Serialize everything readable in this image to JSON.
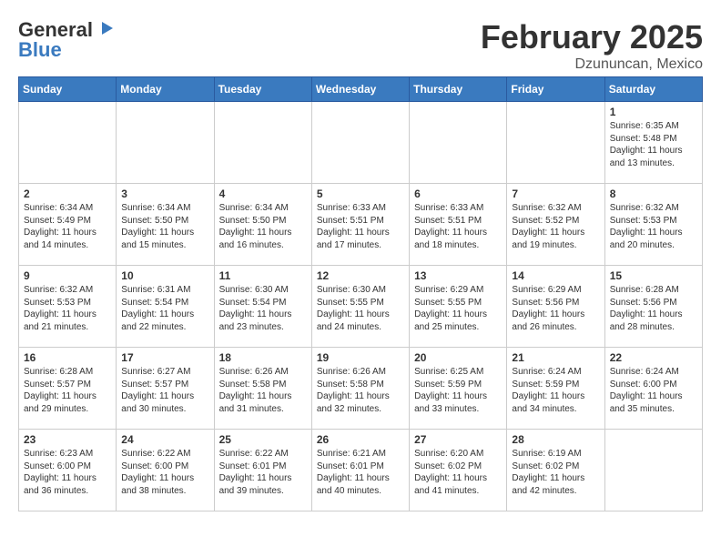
{
  "logo": {
    "general": "General",
    "blue": "Blue"
  },
  "header": {
    "title": "February 2025",
    "subtitle": "Dzununcan, Mexico"
  },
  "weekdays": [
    "Sunday",
    "Monday",
    "Tuesday",
    "Wednesday",
    "Thursday",
    "Friday",
    "Saturday"
  ],
  "weeks": [
    [
      {
        "day": "",
        "info": ""
      },
      {
        "day": "",
        "info": ""
      },
      {
        "day": "",
        "info": ""
      },
      {
        "day": "",
        "info": ""
      },
      {
        "day": "",
        "info": ""
      },
      {
        "day": "",
        "info": ""
      },
      {
        "day": "1",
        "info": "Sunrise: 6:35 AM\nSunset: 5:48 PM\nDaylight: 11 hours\nand 13 minutes."
      }
    ],
    [
      {
        "day": "2",
        "info": "Sunrise: 6:34 AM\nSunset: 5:49 PM\nDaylight: 11 hours\nand 14 minutes."
      },
      {
        "day": "3",
        "info": "Sunrise: 6:34 AM\nSunset: 5:50 PM\nDaylight: 11 hours\nand 15 minutes."
      },
      {
        "day": "4",
        "info": "Sunrise: 6:34 AM\nSunset: 5:50 PM\nDaylight: 11 hours\nand 16 minutes."
      },
      {
        "day": "5",
        "info": "Sunrise: 6:33 AM\nSunset: 5:51 PM\nDaylight: 11 hours\nand 17 minutes."
      },
      {
        "day": "6",
        "info": "Sunrise: 6:33 AM\nSunset: 5:51 PM\nDaylight: 11 hours\nand 18 minutes."
      },
      {
        "day": "7",
        "info": "Sunrise: 6:32 AM\nSunset: 5:52 PM\nDaylight: 11 hours\nand 19 minutes."
      },
      {
        "day": "8",
        "info": "Sunrise: 6:32 AM\nSunset: 5:53 PM\nDaylight: 11 hours\nand 20 minutes."
      }
    ],
    [
      {
        "day": "9",
        "info": "Sunrise: 6:32 AM\nSunset: 5:53 PM\nDaylight: 11 hours\nand 21 minutes."
      },
      {
        "day": "10",
        "info": "Sunrise: 6:31 AM\nSunset: 5:54 PM\nDaylight: 11 hours\nand 22 minutes."
      },
      {
        "day": "11",
        "info": "Sunrise: 6:30 AM\nSunset: 5:54 PM\nDaylight: 11 hours\nand 23 minutes."
      },
      {
        "day": "12",
        "info": "Sunrise: 6:30 AM\nSunset: 5:55 PM\nDaylight: 11 hours\nand 24 minutes."
      },
      {
        "day": "13",
        "info": "Sunrise: 6:29 AM\nSunset: 5:55 PM\nDaylight: 11 hours\nand 25 minutes."
      },
      {
        "day": "14",
        "info": "Sunrise: 6:29 AM\nSunset: 5:56 PM\nDaylight: 11 hours\nand 26 minutes."
      },
      {
        "day": "15",
        "info": "Sunrise: 6:28 AM\nSunset: 5:56 PM\nDaylight: 11 hours\nand 28 minutes."
      }
    ],
    [
      {
        "day": "16",
        "info": "Sunrise: 6:28 AM\nSunset: 5:57 PM\nDaylight: 11 hours\nand 29 minutes."
      },
      {
        "day": "17",
        "info": "Sunrise: 6:27 AM\nSunset: 5:57 PM\nDaylight: 11 hours\nand 30 minutes."
      },
      {
        "day": "18",
        "info": "Sunrise: 6:26 AM\nSunset: 5:58 PM\nDaylight: 11 hours\nand 31 minutes."
      },
      {
        "day": "19",
        "info": "Sunrise: 6:26 AM\nSunset: 5:58 PM\nDaylight: 11 hours\nand 32 minutes."
      },
      {
        "day": "20",
        "info": "Sunrise: 6:25 AM\nSunset: 5:59 PM\nDaylight: 11 hours\nand 33 minutes."
      },
      {
        "day": "21",
        "info": "Sunrise: 6:24 AM\nSunset: 5:59 PM\nDaylight: 11 hours\nand 34 minutes."
      },
      {
        "day": "22",
        "info": "Sunrise: 6:24 AM\nSunset: 6:00 PM\nDaylight: 11 hours\nand 35 minutes."
      }
    ],
    [
      {
        "day": "23",
        "info": "Sunrise: 6:23 AM\nSunset: 6:00 PM\nDaylight: 11 hours\nand 36 minutes."
      },
      {
        "day": "24",
        "info": "Sunrise: 6:22 AM\nSunset: 6:00 PM\nDaylight: 11 hours\nand 38 minutes."
      },
      {
        "day": "25",
        "info": "Sunrise: 6:22 AM\nSunset: 6:01 PM\nDaylight: 11 hours\nand 39 minutes."
      },
      {
        "day": "26",
        "info": "Sunrise: 6:21 AM\nSunset: 6:01 PM\nDaylight: 11 hours\nand 40 minutes."
      },
      {
        "day": "27",
        "info": "Sunrise: 6:20 AM\nSunset: 6:02 PM\nDaylight: 11 hours\nand 41 minutes."
      },
      {
        "day": "28",
        "info": "Sunrise: 6:19 AM\nSunset: 6:02 PM\nDaylight: 11 hours\nand 42 minutes."
      },
      {
        "day": "",
        "info": ""
      }
    ]
  ]
}
